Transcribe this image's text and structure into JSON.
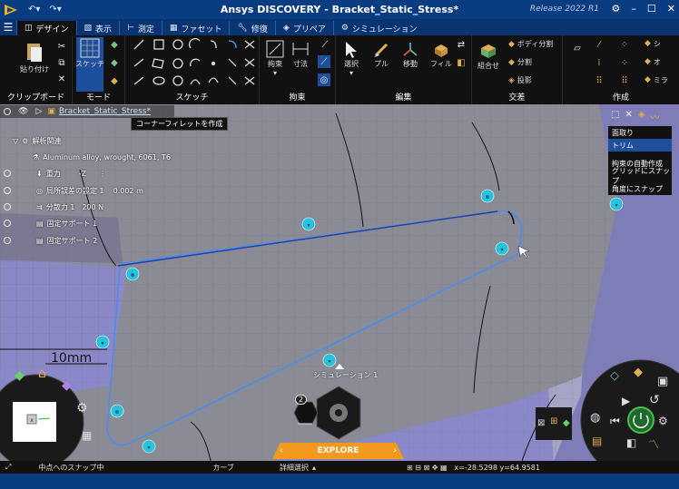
{
  "window": {
    "title": "Ansys DISCOVERY - Bracket_Static_Stress*",
    "release": "Release 2022 R1"
  },
  "tabs": [
    {
      "label": "デザイン",
      "icon": "design-icon",
      "active": true
    },
    {
      "label": "表示",
      "icon": "display-icon",
      "active": false
    },
    {
      "label": "測定",
      "icon": "measure-icon",
      "active": false
    },
    {
      "label": "ファセット",
      "icon": "facet-icon",
      "active": false
    },
    {
      "label": "修復",
      "icon": "repair-icon",
      "active": false
    },
    {
      "label": "プリペア",
      "icon": "prepare-icon",
      "active": false
    },
    {
      "label": "シミュレーション",
      "icon": "simulation-icon",
      "active": false
    }
  ],
  "ribbon": {
    "clipboard": {
      "label": "クリップボード",
      "paste": "貼り付け"
    },
    "mode": {
      "label": "モード",
      "sketch": "スケッチ"
    },
    "sketch": {
      "label": "スケッチ"
    },
    "constraint": {
      "label": "拘束",
      "constrain": "拘束",
      "dimension": "寸法"
    },
    "edit": {
      "label": "編集",
      "select": "選択",
      "pull": "プル",
      "move": "移動",
      "fill": "フィル"
    },
    "intersect": {
      "label": "交差",
      "combine": "組合せ",
      "split_body": "ボディ分割",
      "split": "分割",
      "project": "投影"
    },
    "create": {
      "label": "作成",
      "item1": "シ",
      "item2": "オ",
      "item3": "ミラ"
    }
  },
  "tree": {
    "root": "Bracket_Static_Stress*",
    "tooltip": "コーナーフィレットを作成",
    "items": [
      {
        "label": "解析関連",
        "value": ""
      },
      {
        "label": "Aluminum alloy, wrought, 6061, T6",
        "value": ""
      },
      {
        "label": "重力",
        "value": "-Z"
      },
      {
        "label": "局所誤差の設定 1",
        "value": "0.002 m"
      },
      {
        "label": "分散力 1",
        "value": "200 N"
      },
      {
        "label": "固定サポート 1",
        "value": ""
      },
      {
        "label": "固定サポート 2",
        "value": ""
      }
    ]
  },
  "context_menu": {
    "items": [
      "面取り",
      "トリム",
      "拘束の自動作成",
      "グリッドにスナップ",
      "角度にスナップ"
    ],
    "selected": "トリム"
  },
  "viewport": {
    "dimension_label": "10mm",
    "simulation_label": "シミュレーション 1",
    "stage_number": "2"
  },
  "explore": {
    "label": "EXPLORE"
  },
  "status": {
    "snap": "中点へのスナップ中",
    "mode": "カーブ",
    "selection": "詳細選択",
    "coords": "x=-28.5298  y=64.9581"
  },
  "colors": {
    "title_bar": "#0a3c82",
    "ribbon": "#111111",
    "accent": "#2d8bd6",
    "explore": "#f39a1e",
    "cyan_marker": "#27c2dc",
    "sketch_line": "#4a8df0"
  }
}
